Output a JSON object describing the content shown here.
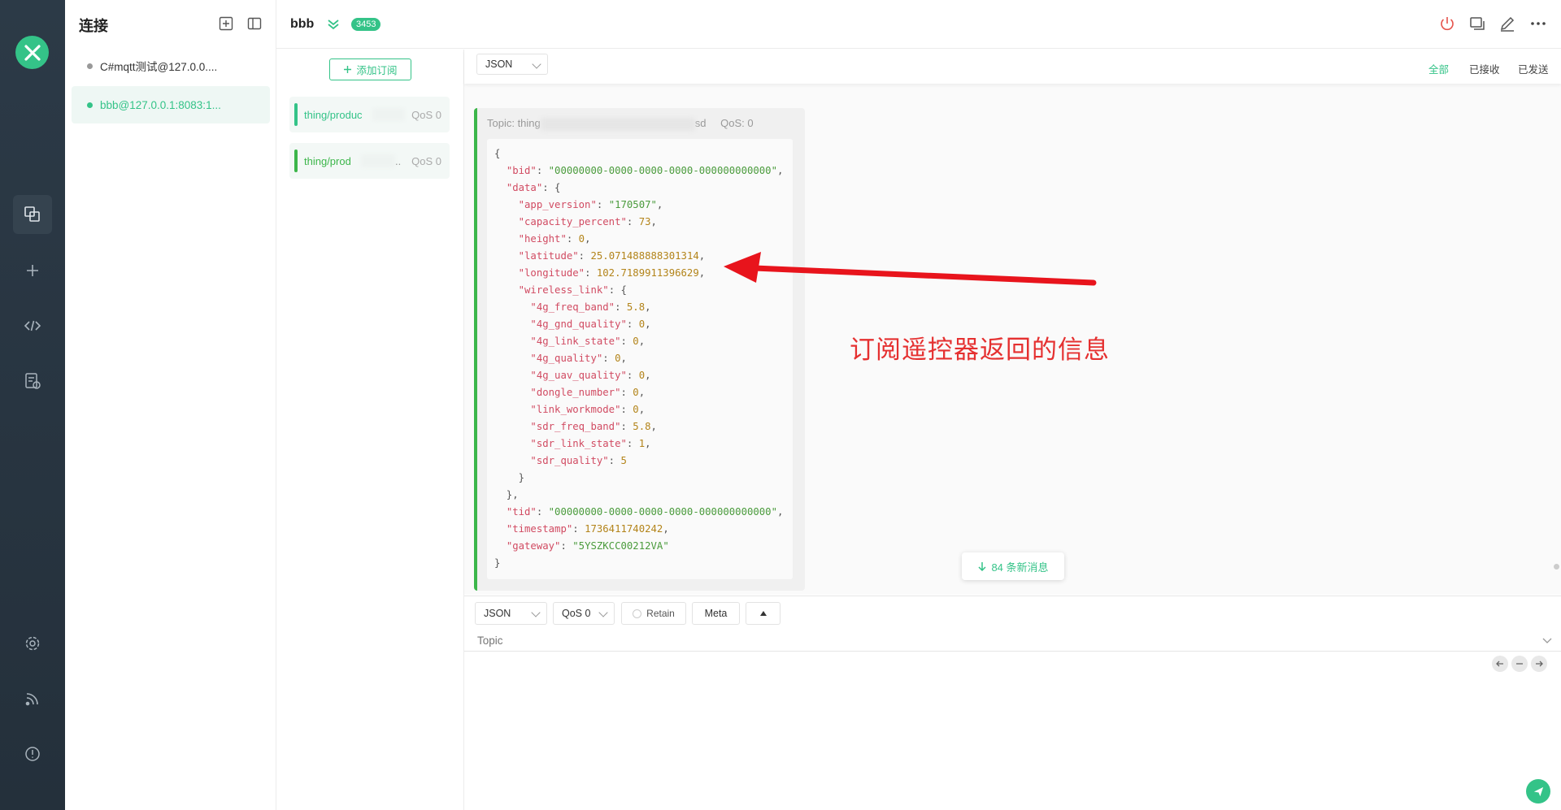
{
  "app": {
    "brand_color": "#34c388",
    "rail_color": "#2c3a47",
    "rail_icons": [
      "connections-icon",
      "plus-icon",
      "script-icon",
      "log-icon",
      "settings-icon",
      "subscription-icon",
      "about-icon"
    ]
  },
  "connections": {
    "title": "连接",
    "items": [
      {
        "label": "C#mqtt测试@127.0.0....",
        "status_color": "#999999"
      },
      {
        "label": "bbb@127.0.0.1:8083:1...",
        "status_color": "#34c388"
      }
    ]
  },
  "subscriptions": {
    "add_label": "添加订阅",
    "items": [
      {
        "topic": "thing/produc",
        "qos": "QoS 0",
        "color": "#34c388"
      },
      {
        "topic": "thing/prod",
        "suffix": "..",
        "qos": "QoS 0",
        "color": "#3cb64a"
      }
    ]
  },
  "header": {
    "connection_name": "bbb",
    "message_count": "3453"
  },
  "messages": {
    "format": "JSON",
    "filters": {
      "all": "全部",
      "received": "已接收",
      "sent": "已发送"
    },
    "card": {
      "topic_prefix": "Topic: thing",
      "topic_suffix": "sd",
      "qos": "QoS: 0"
    },
    "payload": {
      "bid": "00000000-0000-0000-0000-000000000000",
      "data": {
        "app_version": "170507",
        "capacity_percent": 73,
        "height": 0,
        "latitude": 25.071488888301314,
        "longitude": 102.7189911396629,
        "wireless_link": {
          "4g_freq_band": 5.8,
          "4g_gnd_quality": 0,
          "4g_link_state": 0,
          "4g_quality": 0,
          "4g_uav_quality": 0,
          "dongle_number": 0,
          "link_workmode": 0,
          "sdr_freq_band": 5.8,
          "sdr_link_state": 1,
          "sdr_quality": 5
        }
      },
      "tid": "00000000-0000-0000-0000-000000000000",
      "timestamp": 1736411740242,
      "gateway": "5YSZKCC00212VA"
    },
    "new_messages_label": "84 条新消息"
  },
  "annotation": {
    "text": "订阅遥控器返回的信息",
    "color": "#e53030"
  },
  "publish": {
    "format": "JSON",
    "qos": "QoS 0",
    "retain_label": "Retain",
    "meta_label": "Meta",
    "topic_placeholder": "Topic"
  }
}
